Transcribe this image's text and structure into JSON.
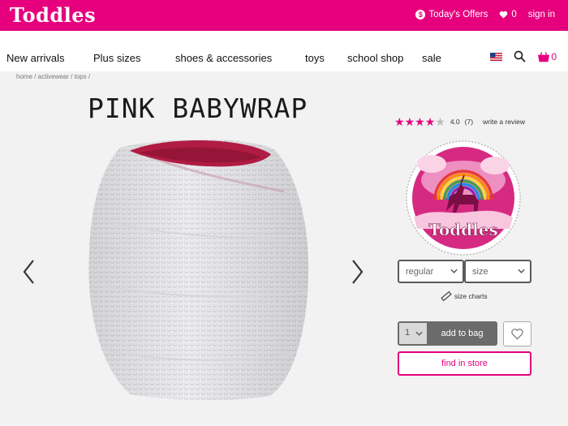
{
  "brand": {
    "logo": "Toddles"
  },
  "top_actions": {
    "offers_label": "Today's Offers",
    "wishlist_count": "0",
    "signin_label": "sign in"
  },
  "nav": {
    "items": [
      "New arrivals",
      "Plus sizes",
      "shoes & accessories",
      "toys",
      "school shop",
      "sale"
    ],
    "cart_count": "0"
  },
  "breadcrumb": "home / activewear / tops /",
  "product": {
    "title": "PINK BABYWRAP",
    "rating_value": "4.0",
    "review_count": "(7)",
    "stars_filled": 4,
    "stars_total": 5,
    "write_review": "write a review",
    "fit_selected": "regular",
    "size_placeholder": "size",
    "size_charts": "size charts",
    "quantity": "1",
    "add_to_bag": "add to bag",
    "find_in_store": "find in store"
  },
  "badge": {
    "text": "Toddles"
  },
  "colors": {
    "brand_pink": "#e6007e",
    "button_gray": "#6b6b6b"
  }
}
